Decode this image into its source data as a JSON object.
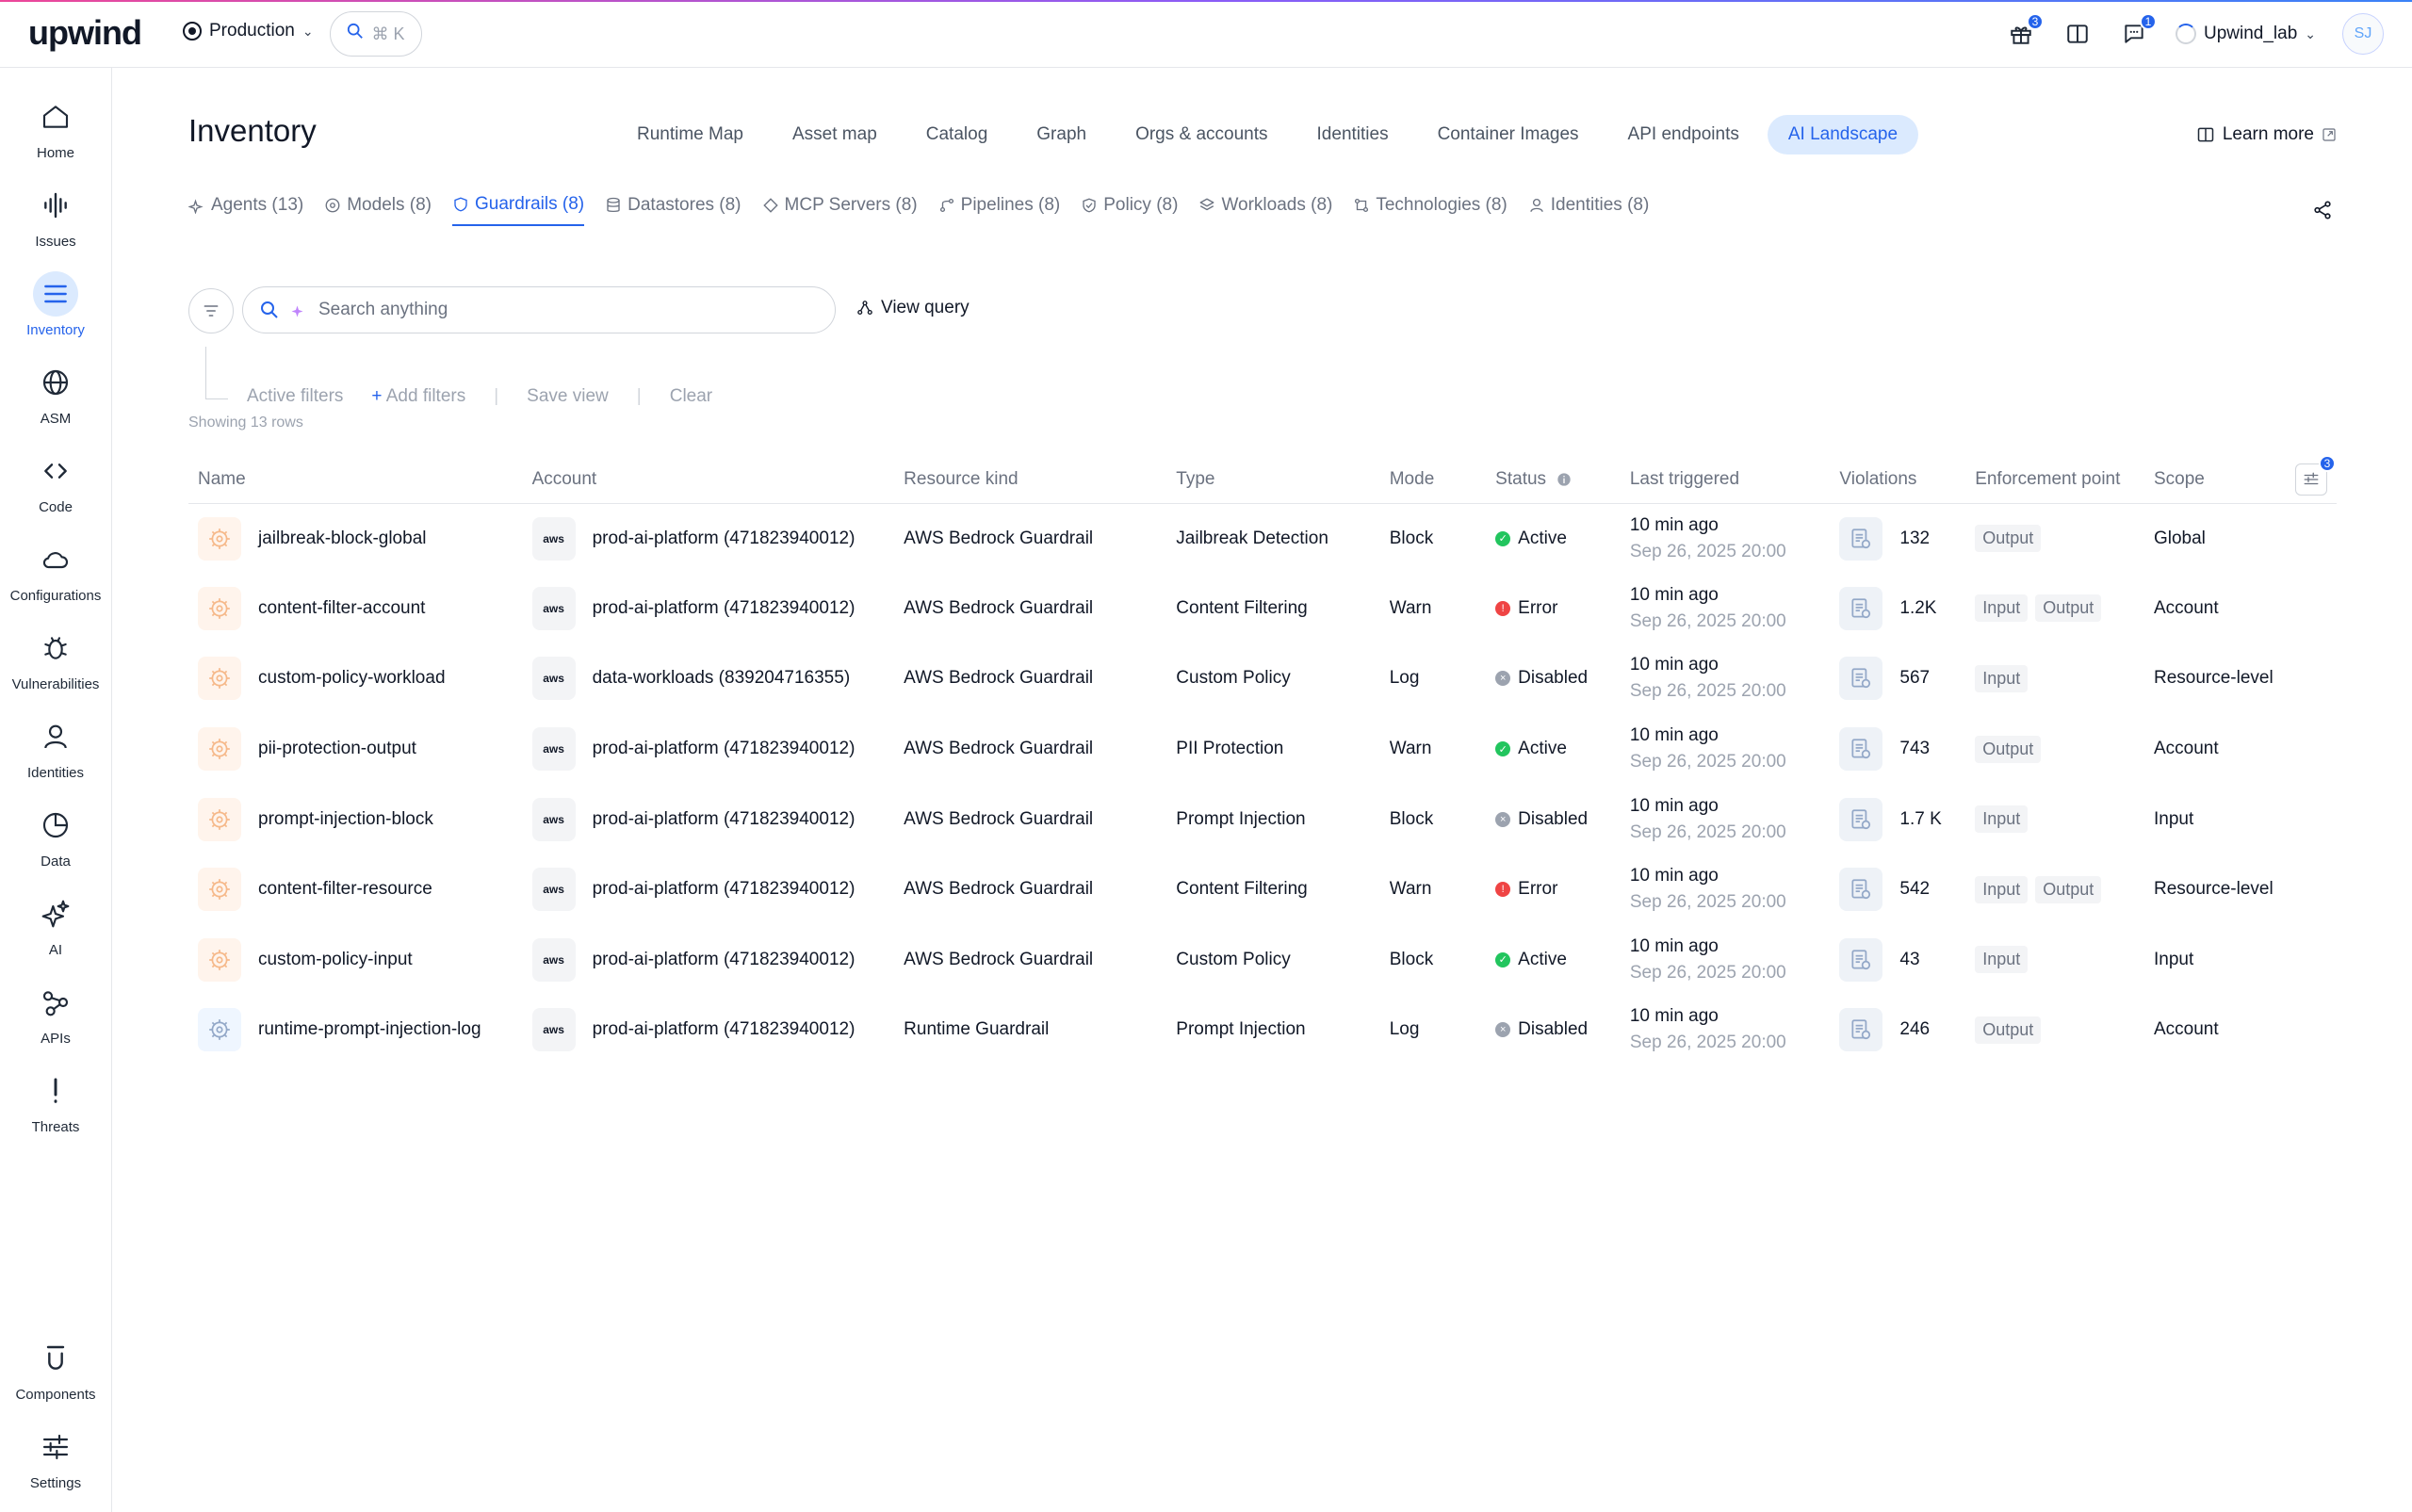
{
  "topbar": {
    "logo": "upwind",
    "environment": "Production",
    "command_shortcut": "⌘ K",
    "gift_badge": "3",
    "chat_badge": "1",
    "account_name": "Upwind_lab",
    "avatar_initials": "SJ"
  },
  "sidebar": {
    "items": [
      {
        "label": "Home",
        "icon": "home-icon"
      },
      {
        "label": "Issues",
        "icon": "issues-icon"
      },
      {
        "label": "Inventory",
        "icon": "inventory-icon"
      },
      {
        "label": "ASM",
        "icon": "globe-icon"
      },
      {
        "label": "Code",
        "icon": "code-icon"
      },
      {
        "label": "Configurations",
        "icon": "cloud-icon"
      },
      {
        "label": "Vulnerabilities",
        "icon": "bug-icon"
      },
      {
        "label": "Identities",
        "icon": "user-icon"
      },
      {
        "label": "Data",
        "icon": "pie-icon"
      },
      {
        "label": "AI",
        "icon": "sparkle-icon"
      },
      {
        "label": "APIs",
        "icon": "share-nodes-icon"
      },
      {
        "label": "Threats",
        "icon": "exclamation-icon"
      }
    ],
    "bottom_items": [
      {
        "label": "Components",
        "icon": "components-icon"
      },
      {
        "label": "Settings",
        "icon": "sliders-icon"
      }
    ],
    "active": "Inventory",
    "accent_color": "#2563eb"
  },
  "page": {
    "title": "Inventory",
    "learn_more": "Learn more",
    "top_tabs": [
      "Runtime Map",
      "Asset map",
      "Catalog",
      "Graph",
      "Orgs & accounts",
      "Identities",
      "Container Images",
      "API endpoints",
      "AI Landscape"
    ],
    "active_top_tab": "AI Landscape",
    "sub_tabs": [
      {
        "label": "Agents (13)",
        "icon": "agent-icon"
      },
      {
        "label": "Models (8)",
        "icon": "model-icon"
      },
      {
        "label": "Guardrails (8)",
        "icon": "shield-icon"
      },
      {
        "label": "Datastores (8)",
        "icon": "database-icon"
      },
      {
        "label": "MCP Servers (8)",
        "icon": "mcp-icon"
      },
      {
        "label": "Pipelines (8)",
        "icon": "pipeline-icon"
      },
      {
        "label": "Policy (8)",
        "icon": "policy-icon"
      },
      {
        "label": "Workloads (8)",
        "icon": "layers-icon"
      },
      {
        "label": "Technologies (8)",
        "icon": "tech-icon"
      },
      {
        "label": "Identities (8)",
        "icon": "user-icon"
      }
    ],
    "active_sub_tab": "Guardrails (8)"
  },
  "filters": {
    "search_placeholder": "Search anything",
    "view_query": "View query",
    "active_filters": "Active filters",
    "add_filters": "Add filters",
    "save_view": "Save view",
    "clear": "Clear",
    "showing": "Showing 13 rows"
  },
  "table": {
    "columns": [
      "Name",
      "Account",
      "Resource kind",
      "Type",
      "Mode",
      "Status",
      "Last triggered",
      "Violations",
      "Enforcement point",
      "Scope"
    ],
    "column_settings_badge": "3",
    "rows": [
      {
        "name": "jailbreak-block-global",
        "account": "prod-ai-platform (471823940012)",
        "resource_kind": "AWS Bedrock Guardrail",
        "type": "Jailbreak Detection",
        "mode": "Block",
        "status": "Active",
        "last_triggered": "10 min ago",
        "last_triggered_date": "Sep 26, 2025 20:00",
        "violations": "132",
        "enforcement": [
          "Output"
        ],
        "scope": "Global"
      },
      {
        "name": "content-filter-account",
        "account": "prod-ai-platform (471823940012)",
        "resource_kind": "AWS Bedrock Guardrail",
        "type": "Content Filtering",
        "mode": "Warn",
        "status": "Error",
        "last_triggered": "10 min ago",
        "last_triggered_date": "Sep 26, 2025 20:00",
        "violations": "1.2K",
        "enforcement": [
          "Input",
          "Output"
        ],
        "scope": "Account"
      },
      {
        "name": "custom-policy-workload",
        "account": "data-workloads (839204716355)",
        "resource_kind": "AWS Bedrock Guardrail",
        "type": "Custom Policy",
        "mode": "Log",
        "status": "Disabled",
        "last_triggered": "10 min ago",
        "last_triggered_date": "Sep 26, 2025 20:00",
        "violations": "567",
        "enforcement": [
          "Input"
        ],
        "scope": "Resource-level"
      },
      {
        "name": "pii-protection-output",
        "account": "prod-ai-platform (471823940012)",
        "resource_kind": "AWS Bedrock Guardrail",
        "type": "PII Protection",
        "mode": "Warn",
        "status": "Active",
        "last_triggered": "10 min ago",
        "last_triggered_date": "Sep 26, 2025 20:00",
        "violations": "743",
        "enforcement": [
          "Output"
        ],
        "scope": "Account"
      },
      {
        "name": "prompt-injection-block",
        "account": "prod-ai-platform (471823940012)",
        "resource_kind": "AWS Bedrock Guardrail",
        "type": "Prompt Injection",
        "mode": "Block",
        "status": "Disabled",
        "last_triggered": "10 min ago",
        "last_triggered_date": "Sep 26, 2025 20:00",
        "violations": "1.7 K",
        "enforcement": [
          "Input"
        ],
        "scope": "Input"
      },
      {
        "name": "content-filter-resource",
        "account": "prod-ai-platform (471823940012)",
        "resource_kind": "AWS Bedrock Guardrail",
        "type": "Content Filtering",
        "mode": "Warn",
        "status": "Error",
        "last_triggered": "10 min ago",
        "last_triggered_date": "Sep 26, 2025 20:00",
        "violations": "542",
        "enforcement": [
          "Input",
          "Output"
        ],
        "scope": "Resource-level"
      },
      {
        "name": "custom-policy-input",
        "account": "prod-ai-platform (471823940012)",
        "resource_kind": "AWS Bedrock Guardrail",
        "type": "Custom Policy",
        "mode": "Block",
        "status": "Active",
        "last_triggered": "10 min ago",
        "last_triggered_date": "Sep 26, 2025 20:00",
        "violations": "43",
        "enforcement": [
          "Input"
        ],
        "scope": "Input"
      },
      {
        "name": "runtime-prompt-injection-log",
        "account": "prod-ai-platform (471823940012)",
        "resource_kind": "Runtime Guardrail",
        "type": "Prompt Injection",
        "mode": "Log",
        "status": "Disabled",
        "last_triggered": "10 min ago",
        "last_triggered_date": "Sep 26, 2025 20:00",
        "violations": "246",
        "enforcement": [
          "Output"
        ],
        "scope": "Account"
      }
    ]
  },
  "colors": {
    "status_active": "#22c55e",
    "status_error": "#ef4444",
    "status_disabled": "#9ca3af",
    "link": "#2563eb"
  }
}
